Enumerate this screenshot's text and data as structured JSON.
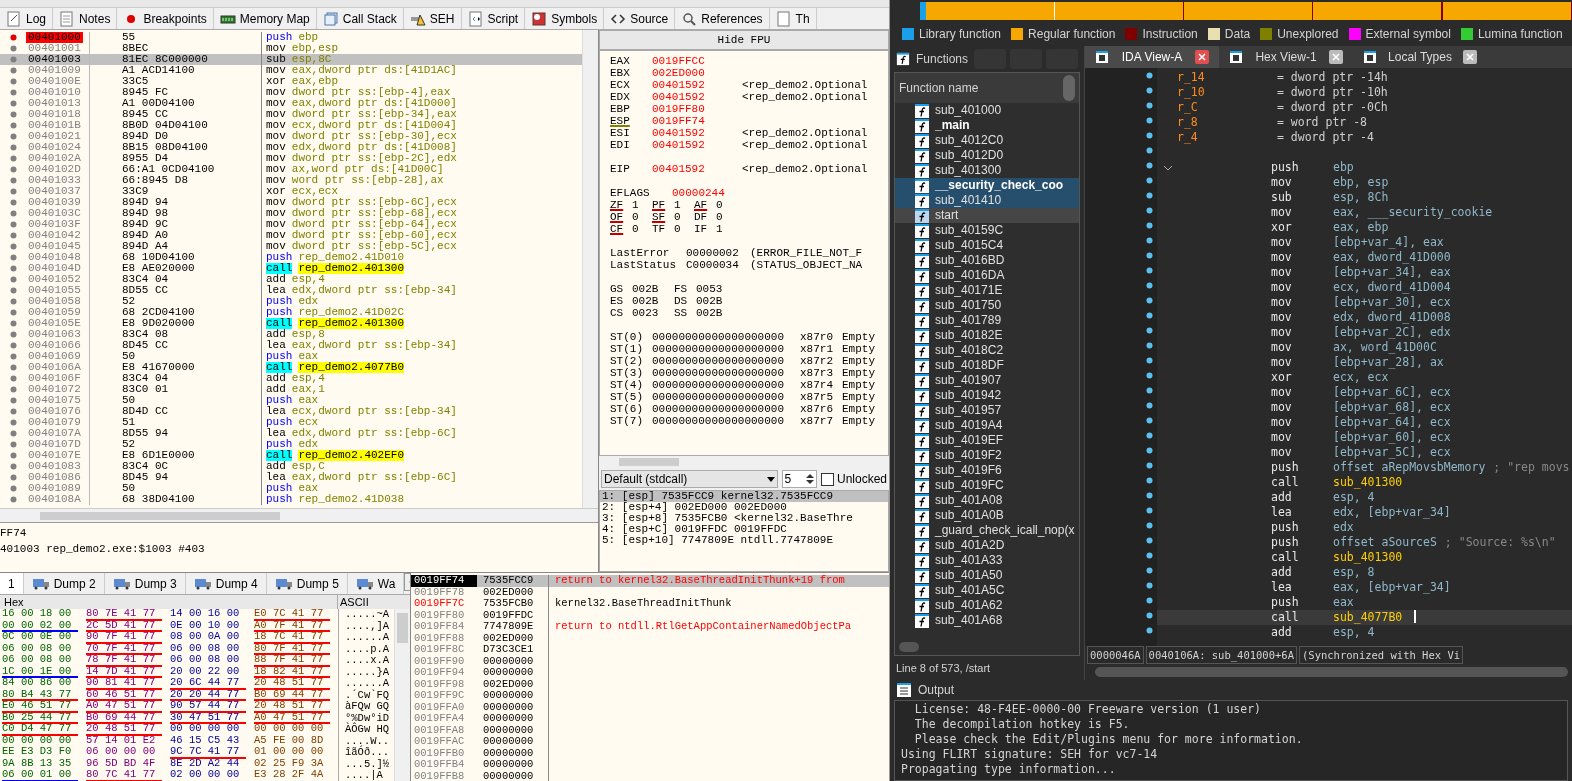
{
  "x64dbg": {
    "tabs": [
      {
        "label": "Log"
      },
      {
        "label": "Notes"
      },
      {
        "label": "Breakpoints"
      },
      {
        "label": "Memory Map"
      },
      {
        "label": "Call Stack"
      },
      {
        "label": "SEH"
      },
      {
        "label": "Script"
      },
      {
        "label": "Symbols"
      },
      {
        "label": "Source"
      },
      {
        "label": "References"
      },
      {
        "label": "Th"
      }
    ],
    "disassembly": [
      {
        "address": "00401000",
        "bytes": "55",
        "mnemonic": "push",
        "operands": "ebp",
        "kind": "push",
        "breakpoint": true,
        "selected": false
      },
      {
        "address": "00401001",
        "bytes": "8BEC",
        "mnemonic": "mov",
        "operands": "ebp,esp",
        "kind": "plain",
        "breakpoint": false,
        "selected": false
      },
      {
        "address": "00401003",
        "bytes": "81EC 8C000000",
        "mnemonic": "sub",
        "operands": "esp,8C",
        "kind": "plain",
        "breakpoint": false,
        "selected": true
      },
      {
        "address": "00401009",
        "bytes": "A1 ACD14100",
        "mnemonic": "mov",
        "operands": "eax,dword ptr ds:[41D1AC]",
        "kind": "plain",
        "breakpoint": false,
        "selected": false
      },
      {
        "address": "0040100E",
        "bytes": "33C5",
        "mnemonic": "xor",
        "operands": "eax,ebp",
        "kind": "plain",
        "breakpoint": false,
        "selected": false
      },
      {
        "address": "00401010",
        "bytes": "8945 FC",
        "mnemonic": "mov",
        "operands": "dword ptr ss:[ebp-4],eax",
        "kind": "plain",
        "breakpoint": false,
        "selected": false
      },
      {
        "address": "00401013",
        "bytes": "A1 00D04100",
        "mnemonic": "mov",
        "operands": "eax,dword ptr ds:[41D000]",
        "kind": "plain",
        "breakpoint": false,
        "selected": false
      },
      {
        "address": "00401018",
        "bytes": "8945 CC",
        "mnemonic": "mov",
        "operands": "dword ptr ss:[ebp-34],eax",
        "kind": "plain",
        "breakpoint": false,
        "selected": false
      },
      {
        "address": "0040101B",
        "bytes": "8B0D 04D04100",
        "mnemonic": "mov",
        "operands": "ecx,dword ptr ds:[41D004]",
        "kind": "plain",
        "breakpoint": false,
        "selected": false
      },
      {
        "address": "00401021",
        "bytes": "894D D0",
        "mnemonic": "mov",
        "operands": "dword ptr ss:[ebp-30],ecx",
        "kind": "plain",
        "breakpoint": false,
        "selected": false
      },
      {
        "address": "00401024",
        "bytes": "8B15 08D04100",
        "mnemonic": "mov",
        "operands": "edx,dword ptr ds:[41D008]",
        "kind": "plain",
        "breakpoint": false,
        "selected": false
      },
      {
        "address": "0040102A",
        "bytes": "8955 D4",
        "mnemonic": "mov",
        "operands": "dword ptr ss:[ebp-2C],edx",
        "kind": "plain",
        "breakpoint": false,
        "selected": false
      },
      {
        "address": "0040102D",
        "bytes": "66:A1 0CD04100",
        "mnemonic": "mov",
        "operands": "ax,word ptr ds:[41D00C]",
        "kind": "plain",
        "breakpoint": false,
        "selected": false
      },
      {
        "address": "00401033",
        "bytes": "66:8945 D8",
        "mnemonic": "mov",
        "operands": "word ptr ss:[ebp-28],ax",
        "kind": "plain",
        "breakpoint": false,
        "selected": false
      },
      {
        "address": "00401037",
        "bytes": "33C9",
        "mnemonic": "xor",
        "operands": "ecx,ecx",
        "kind": "plain",
        "breakpoint": false,
        "selected": false
      },
      {
        "address": "00401039",
        "bytes": "894D 94",
        "mnemonic": "mov",
        "operands": "dword ptr ss:[ebp-6C],ecx",
        "kind": "plain",
        "breakpoint": false,
        "selected": false
      },
      {
        "address": "0040103C",
        "bytes": "894D 98",
        "mnemonic": "mov",
        "operands": "dword ptr ss:[ebp-68],ecx",
        "kind": "plain",
        "breakpoint": false,
        "selected": false
      },
      {
        "address": "0040103F",
        "bytes": "894D 9C",
        "mnemonic": "mov",
        "operands": "dword ptr ss:[ebp-64],ecx",
        "kind": "plain",
        "breakpoint": false,
        "selected": false
      },
      {
        "address": "00401042",
        "bytes": "894D A0",
        "mnemonic": "mov",
        "operands": "dword ptr ss:[ebp-60],ecx",
        "kind": "plain",
        "breakpoint": false,
        "selected": false
      },
      {
        "address": "00401045",
        "bytes": "894D A4",
        "mnemonic": "mov",
        "operands": "dword ptr ss:[ebp-5C],ecx",
        "kind": "plain",
        "breakpoint": false,
        "selected": false
      },
      {
        "address": "00401048",
        "bytes": "68 10D04100",
        "mnemonic": "push",
        "operands": "rep_demo2.41D010",
        "kind": "push",
        "breakpoint": false,
        "selected": false
      },
      {
        "address": "0040104D",
        "bytes": "E8 AE020000",
        "mnemonic": "call",
        "operands": "rep_demo2.401300",
        "kind": "call",
        "breakpoint": false,
        "selected": false
      },
      {
        "address": "00401052",
        "bytes": "83C4 04",
        "mnemonic": "add",
        "operands": "esp,4",
        "kind": "plain",
        "breakpoint": false,
        "selected": false
      },
      {
        "address": "00401055",
        "bytes": "8D55 CC",
        "mnemonic": "lea",
        "operands": "edx,dword ptr ss:[ebp-34]",
        "kind": "plain",
        "breakpoint": false,
        "selected": false
      },
      {
        "address": "00401058",
        "bytes": "52",
        "mnemonic": "push",
        "operands": "edx",
        "kind": "push",
        "breakpoint": false,
        "selected": false
      },
      {
        "address": "00401059",
        "bytes": "68 2CD04100",
        "mnemonic": "push",
        "operands": "rep_demo2.41D02C",
        "kind": "push",
        "breakpoint": false,
        "selected": false
      },
      {
        "address": "0040105E",
        "bytes": "E8 9D020000",
        "mnemonic": "call",
        "operands": "rep_demo2.401300",
        "kind": "call",
        "breakpoint": false,
        "selected": false
      },
      {
        "address": "00401063",
        "bytes": "83C4 08",
        "mnemonic": "add",
        "operands": "esp,8",
        "kind": "plain",
        "breakpoint": false,
        "selected": false
      },
      {
        "address": "00401066",
        "bytes": "8D45 CC",
        "mnemonic": "lea",
        "operands": "eax,dword ptr ss:[ebp-34]",
        "kind": "plain",
        "breakpoint": false,
        "selected": false
      },
      {
        "address": "00401069",
        "bytes": "50",
        "mnemonic": "push",
        "operands": "eax",
        "kind": "push",
        "breakpoint": false,
        "selected": false
      },
      {
        "address": "0040106A",
        "bytes": "E8 41670000",
        "mnemonic": "call",
        "operands": "rep_demo2.4077B0",
        "kind": "call",
        "breakpoint": false,
        "selected": false
      },
      {
        "address": "0040106F",
        "bytes": "83C4 04",
        "mnemonic": "add",
        "operands": "esp,4",
        "kind": "plain",
        "breakpoint": false,
        "selected": false
      },
      {
        "address": "00401072",
        "bytes": "83C0 01",
        "mnemonic": "add",
        "operands": "eax,1",
        "kind": "plain",
        "breakpoint": false,
        "selected": false
      },
      {
        "address": "00401075",
        "bytes": "50",
        "mnemonic": "push",
        "operands": "eax",
        "kind": "push",
        "breakpoint": false,
        "selected": false
      },
      {
        "address": "00401076",
        "bytes": "8D4D CC",
        "mnemonic": "lea",
        "operands": "ecx,dword ptr ss:[ebp-34]",
        "kind": "plain",
        "breakpoint": false,
        "selected": false
      },
      {
        "address": "00401079",
        "bytes": "51",
        "mnemonic": "push",
        "operands": "ecx",
        "kind": "push",
        "breakpoint": false,
        "selected": false
      },
      {
        "address": "0040107A",
        "bytes": "8D55 94",
        "mnemonic": "lea",
        "operands": "edx,dword ptr ss:[ebp-6C]",
        "kind": "plain",
        "breakpoint": false,
        "selected": false
      },
      {
        "address": "0040107D",
        "bytes": "52",
        "mnemonic": "push",
        "operands": "edx",
        "kind": "push",
        "breakpoint": false,
        "selected": false
      },
      {
        "address": "0040107E",
        "bytes": "E8 6D1E0000",
        "mnemonic": "call",
        "operands": "rep_demo2.402EF0",
        "kind": "call",
        "breakpoint": false,
        "selected": false
      },
      {
        "address": "00401083",
        "bytes": "83C4 0C",
        "mnemonic": "add",
        "operands": "esp,C",
        "kind": "plain",
        "breakpoint": false,
        "selected": false
      },
      {
        "address": "00401086",
        "bytes": "8D45 94",
        "mnemonic": "lea",
        "operands": "eax,dword ptr ss:[ebp-6C]",
        "kind": "plain",
        "breakpoint": false,
        "selected": false
      },
      {
        "address": "00401089",
        "bytes": "50",
        "mnemonic": "push",
        "operands": "eax",
        "kind": "push",
        "breakpoint": false,
        "selected": false
      },
      {
        "address": "0040108A",
        "bytes": "68 38D04100",
        "mnemonic": "push",
        "operands": "rep_demo2.41D038",
        "kind": "push",
        "breakpoint": false,
        "selected": false
      }
    ],
    "fpu_toggle": "Hide FPU",
    "registers": [
      {
        "name": "EAX",
        "value": "0019FFCC",
        "marked": false
      },
      {
        "name": "EBX",
        "value": "002ED000",
        "marked": false
      },
      {
        "name": "ECX",
        "value": "00401592",
        "comment": "<rep_demo2.Optional",
        "marked": false
      },
      {
        "name": "EDX",
        "value": "00401592",
        "comment": "<rep_demo2.Optional",
        "marked": false
      },
      {
        "name": "EBP",
        "value": "0019FF80",
        "marked": false
      },
      {
        "name": "ESP",
        "value": "0019FF74",
        "marked": true
      },
      {
        "name": "ESI",
        "value": "00401592",
        "comment": "<rep_demo2.Optional",
        "marked": false
      },
      {
        "name": "EDI",
        "value": "00401592",
        "comment": "<rep_demo2.Optional",
        "marked": false
      }
    ],
    "eip": {
      "name": "EIP",
      "value": "00401592",
      "comment": "<rep_demo2.Optional"
    },
    "eflags": {
      "name": "EFLAGS",
      "value": "00000244"
    },
    "flags": [
      {
        "name": "ZF",
        "value": "1",
        "marked": true
      },
      {
        "name": "PF",
        "value": "1",
        "marked": true
      },
      {
        "name": "AF",
        "value": "0",
        "marked": true
      },
      {
        "name": "OF",
        "value": "0",
        "marked": true
      },
      {
        "name": "SF",
        "value": "0",
        "marked": true
      },
      {
        "name": "DF",
        "value": "0",
        "marked": false
      },
      {
        "name": "CF",
        "value": "0",
        "marked": true
      },
      {
        "name": "TF",
        "value": "0",
        "marked": false
      },
      {
        "name": "IF",
        "value": "1",
        "marked": false
      }
    ],
    "last": [
      {
        "name": "LastError",
        "value": "00000002",
        "comment": "(ERROR_FILE_NOT_F"
      },
      {
        "name": "LastStatus",
        "value": "C0000034",
        "comment": "(STATUS_OBJECT_NA"
      }
    ],
    "segments": [
      {
        "name": "GS",
        "value": "002B"
      },
      {
        "name": "FS",
        "value": "0053"
      },
      {
        "name": "ES",
        "value": "002B"
      },
      {
        "name": "DS",
        "value": "002B"
      },
      {
        "name": "CS",
        "value": "0023"
      },
      {
        "name": "SS",
        "value": "002B"
      }
    ],
    "fpu": [
      {
        "name": "ST(0)",
        "value": "00000000000000000000",
        "tag": "x87r0",
        "state": "Empty"
      },
      {
        "name": "ST(1)",
        "value": "00000000000000000000",
        "tag": "x87r1",
        "state": "Empty"
      },
      {
        "name": "ST(2)",
        "value": "00000000000000000000",
        "tag": "x87r2",
        "state": "Empty"
      },
      {
        "name": "ST(3)",
        "value": "00000000000000000000",
        "tag": "x87r3",
        "state": "Empty"
      },
      {
        "name": "ST(4)",
        "value": "00000000000000000000",
        "tag": "x87r4",
        "state": "Empty"
      },
      {
        "name": "ST(5)",
        "value": "00000000000000000000",
        "tag": "x87r5",
        "state": "Empty"
      },
      {
        "name": "ST(6)",
        "value": "00000000000000000000",
        "tag": "x87r6",
        "state": "Empty"
      },
      {
        "name": "ST(7)",
        "value": "00000000000000000000",
        "tag": "x87r7",
        "state": "Empty"
      }
    ],
    "call_convention": {
      "value": "Default (stdcall)",
      "count": "5",
      "lock_label": "Unlocked",
      "checked": false
    },
    "arguments": [
      {
        "text": "1: [esp] 7535FCC9 kernel32.7535FCC9",
        "selected": true
      },
      {
        "text": "2: [esp+4] 002ED000 002ED000",
        "selected": false
      },
      {
        "text": "3: [esp+8] 7535FCB0 <kernel32.BaseThre",
        "selected": false
      },
      {
        "text": "4: [esp+C] 0019FFDC 0019FFDC",
        "selected": false
      },
      {
        "text": "5: [esp+10] 7747809E ntdll.7747809E",
        "selected": false
      }
    ],
    "info": [
      "FF74",
      "401003 rep_demo2.exe:$1003 #403"
    ],
    "dump_tabs": [
      {
        "label": "1",
        "selected": true
      },
      {
        "label": "Dump 2",
        "selected": false
      },
      {
        "label": "Dump 3",
        "selected": false
      },
      {
        "label": "Dump 4",
        "selected": false
      },
      {
        "label": "Dump 5",
        "selected": false
      },
      {
        "label": "Wa",
        "selected": false
      }
    ],
    "hex_header": "Hex",
    "ascii_header": "ASCII",
    "hex_rows": [
      {
        "groups": [
          {
            "text": "16 00 18 00",
            "underlined": false
          },
          {
            "text": "80 7E 41 77",
            "underlined": true,
            "color": "#ff0000"
          },
          {
            "text": "14 00 16 00",
            "underlined": false
          },
          {
            "text": "E0 7C 41 77",
            "underlined": true,
            "color": "#ff0000"
          }
        ],
        "ascii": ".....~A"
      },
      {
        "groups": [
          {
            "text": "00 00 02 00",
            "underlined": true,
            "color": "#0000ff"
          },
          {
            "text": "2C 5D 41 77",
            "underlined": true,
            "color": "#ff0000"
          },
          {
            "text": "0E 00 10 00",
            "underlined": false
          },
          {
            "text": "A0 7F 41 77",
            "underlined": true,
            "color": "#ff0000"
          }
        ],
        "ascii": "....,]A"
      },
      {
        "groups": [
          {
            "text": "0C 00 0E 00",
            "underlined": false
          },
          {
            "text": "90 7F 41 77",
            "underlined": true,
            "color": "#ff0000"
          },
          {
            "text": "08 00 0A 00",
            "underlined": false
          },
          {
            "text": "18 7C 41 77",
            "underlined": true,
            "color": "#ff0000"
          }
        ],
        "ascii": "......A"
      },
      {
        "groups": [
          {
            "text": "06 00 08 00",
            "underlined": false
          },
          {
            "text": "70 7F 41 77",
            "underlined": true,
            "color": "#ff0000"
          },
          {
            "text": "06 00 08 00",
            "underlined": false
          },
          {
            "text": "80 7F 41 77",
            "underlined": true,
            "color": "#ff0000"
          }
        ],
        "ascii": "....p.A"
      },
      {
        "groups": [
          {
            "text": "06 00 08 00",
            "underlined": false
          },
          {
            "text": "78 7F 41 77",
            "underlined": true,
            "color": "#ff0000"
          },
          {
            "text": "06 00 08 00",
            "underlined": false
          },
          {
            "text": "88 7F 41 77",
            "underlined": true,
            "color": "#ff0000"
          }
        ],
        "ascii": "....x.A"
      },
      {
        "groups": [
          {
            "text": "1C 00 1E 00",
            "underlined": true,
            "color": "#0000ff"
          },
          {
            "text": "14 7D 41 77",
            "underlined": true,
            "color": "#ff0000"
          },
          {
            "text": "20 00 22 00",
            "underlined": false
          },
          {
            "text": "18 82 41 77",
            "underlined": true,
            "color": "#ff0000"
          }
        ],
        "ascii": ".....}A"
      },
      {
        "groups": [
          {
            "text": "84 00 86 00",
            "underlined": false
          },
          {
            "text": "90 81 41 77",
            "underlined": true,
            "color": "#ff0000"
          },
          {
            "text": "20 6C 44 77",
            "underlined": true,
            "color": "#ff0000"
          },
          {
            "text": "20 48 51 77",
            "underlined": true,
            "color": "#ff0000"
          }
        ],
        "ascii": "......A"
      },
      {
        "groups": [
          {
            "text": "80 B4 43 77",
            "underlined": true,
            "color": "#ff0000"
          },
          {
            "text": "60 46 51 77",
            "underlined": true,
            "color": "#ff0000"
          },
          {
            "text": "20 20 44 77",
            "underlined": true,
            "color": "#ff0000"
          },
          {
            "text": "B0 69 44 77",
            "underlined": true,
            "color": "#ff0000"
          }
        ],
        "ascii": ".´Cw`FQ"
      },
      {
        "groups": [
          {
            "text": "E0 46 51 77",
            "underlined": true,
            "color": "#ff0000"
          },
          {
            "text": "A0 47 51 77",
            "underlined": true,
            "color": "#ff0000"
          },
          {
            "text": "90 57 44 77",
            "underlined": true,
            "color": "#ff0000"
          },
          {
            "text": "20 48 51 77",
            "underlined": true,
            "color": "#ff0000"
          }
        ],
        "ascii": "àFQw GQ"
      },
      {
        "groups": [
          {
            "text": "B0 25 44 77",
            "underlined": true,
            "color": "#ff0000"
          },
          {
            "text": "B0 69 44 77",
            "underlined": true,
            "color": "#ff0000"
          },
          {
            "text": "30 47 51 77",
            "underlined": true,
            "color": "#ff0000"
          },
          {
            "text": "A0 47 51 77",
            "underlined": true,
            "color": "#ff0000"
          }
        ],
        "ascii": "°%Dw°iD"
      },
      {
        "groups": [
          {
            "text": "C0 D4 47 77",
            "underlined": true,
            "color": "#ff0000"
          },
          {
            "text": "20 48 51 77",
            "underlined": true,
            "color": "#ff0000"
          },
          {
            "text": "00 00 00 00",
            "underlined": false
          },
          {
            "text": "00 00 00 00",
            "underlined": false
          }
        ],
        "ascii": "ÀÔGw HQ"
      },
      {
        "groups": [
          {
            "text": "00 00 00 00",
            "underlined": false
          },
          {
            "text": "57 14 01 E2",
            "underlined": false
          },
          {
            "text": "46 15 C5 43",
            "underlined": false
          },
          {
            "text": "A5 FE 00 8D",
            "underlined": false
          }
        ],
        "ascii": "....W.."
      },
      {
        "groups": [
          {
            "text": "EE E3 D3 F0",
            "underlined": false
          },
          {
            "text": "06 00 00 00",
            "underlined": false
          },
          {
            "text": "9C 7C 41 77",
            "underlined": true,
            "color": "#ff0000"
          },
          {
            "text": "01 00 00 00",
            "underlined": false
          }
        ],
        "ascii": "îãÓð..."
      },
      {
        "groups": [
          {
            "text": "9A 8B 13 35",
            "underlined": false
          },
          {
            "text": "96 5D BD 4F",
            "underlined": false
          },
          {
            "text": "8E 2D A2 44",
            "underlined": false
          },
          {
            "text": "02 25 F9 3A",
            "underlined": false
          }
        ],
        "ascii": "...5.]½"
      },
      {
        "groups": [
          {
            "text": "06 00 01 00",
            "underlined": true,
            "color": "#0000ff"
          },
          {
            "text": "80 7C 41 77",
            "underlined": true,
            "color": "#ff0000"
          },
          {
            "text": "02 00 00 00",
            "underlined": false
          },
          {
            "text": "E3 28 2F 4A",
            "underlined": false
          }
        ],
        "ascii": "....|A"
      }
    ],
    "stack": [
      {
        "address": "0019FF74",
        "value": "7535FCC9",
        "comment": "return to kernel32.BaseThreadInitThunk+19 from",
        "kind": "return",
        "selected": true,
        "marked": false
      },
      {
        "address": "0019FF78",
        "value": "002ED000",
        "kind": "none",
        "selected": false,
        "marked": false
      },
      {
        "address": "0019FF7C",
        "value": "7535FCB0",
        "comment": "kernel32.BaseThreadInitThunk",
        "kind": "label",
        "selected": false,
        "marked": true
      },
      {
        "address": "0019FF80",
        "value": "0019FFDC",
        "kind": "none",
        "selected": false,
        "marked": false
      },
      {
        "address": "0019FF84",
        "value": "7747809E",
        "comment": "return to ntdll.RtlGetAppContainerNamedObjectPa",
        "kind": "return",
        "selected": false,
        "marked": false
      },
      {
        "address": "0019FF88",
        "value": "002ED000",
        "kind": "none",
        "selected": false,
        "marked": false
      },
      {
        "address": "0019FF8C",
        "value": "D73C3CE1",
        "kind": "none",
        "selected": false,
        "marked": false
      },
      {
        "address": "0019FF90",
        "value": "00000000",
        "kind": "none",
        "selected": false,
        "marked": false
      },
      {
        "address": "0019FF94",
        "value": "00000000",
        "kind": "none",
        "selected": false,
        "marked": false
      },
      {
        "address": "0019FF98",
        "value": "002ED000",
        "kind": "none",
        "selected": false,
        "marked": false
      },
      {
        "address": "0019FF9C",
        "value": "00000000",
        "kind": "none",
        "selected": false,
        "marked": false
      },
      {
        "address": "0019FFA0",
        "value": "00000000",
        "kind": "none",
        "selected": false,
        "marked": false
      },
      {
        "address": "0019FFA4",
        "value": "00000000",
        "kind": "none",
        "selected": false,
        "marked": false
      },
      {
        "address": "0019FFA8",
        "value": "00000000",
        "kind": "none",
        "selected": false,
        "marked": false
      },
      {
        "address": "0019FFAC",
        "value": "00000000",
        "kind": "none",
        "selected": false,
        "marked": false
      },
      {
        "address": "0019FFB0",
        "value": "00000000",
        "kind": "none",
        "selected": false,
        "marked": false
      },
      {
        "address": "0019FFB4",
        "value": "00000000",
        "kind": "none",
        "selected": false,
        "marked": false
      },
      {
        "address": "0019FFB8",
        "value": "00000000",
        "kind": "none",
        "selected": false,
        "marked": false
      }
    ]
  },
  "ida": {
    "legend": [
      {
        "label": "Library function",
        "color": "#1a9fe8"
      },
      {
        "label": "Regular function",
        "color": "#f6a800"
      },
      {
        "label": "Instruction",
        "color": "#800000"
      },
      {
        "label": "Data",
        "color": "#e8e0b0"
      },
      {
        "label": "Unexplored",
        "color": "#808000"
      },
      {
        "label": "External symbol",
        "color": "#ff00ff"
      },
      {
        "label": "Lumina function",
        "color": "#33cc33"
      }
    ],
    "functions_title": "Functions",
    "functions_header": "Function name",
    "functions": [
      {
        "name": "sub_401000",
        "bold": false,
        "selected": false,
        "current": false
      },
      {
        "name": "_main",
        "bold": true,
        "selected": false,
        "current": false
      },
      {
        "name": "sub_4012C0",
        "bold": false,
        "selected": false,
        "current": false
      },
      {
        "name": "sub_4012D0",
        "bold": false,
        "selected": false,
        "current": false
      },
      {
        "name": "sub_401300",
        "bold": false,
        "selected": false,
        "current": false
      },
      {
        "name": "__security_check_coo",
        "bold": true,
        "selected": true,
        "current": false
      },
      {
        "name": "sub_401410",
        "bold": false,
        "selected": true,
        "current": false
      },
      {
        "name": "start",
        "bold": false,
        "selected": false,
        "current": true
      },
      {
        "name": "sub_40159C",
        "bold": false,
        "selected": false,
        "current": false
      },
      {
        "name": "sub_4015C4",
        "bold": false,
        "selected": false,
        "current": false
      },
      {
        "name": "sub_4016BD",
        "bold": false,
        "selected": false,
        "current": false
      },
      {
        "name": "sub_4016DA",
        "bold": false,
        "selected": false,
        "current": false
      },
      {
        "name": "sub_40171E",
        "bold": false,
        "selected": false,
        "current": false
      },
      {
        "name": "sub_401750",
        "bold": false,
        "selected": false,
        "current": false
      },
      {
        "name": "sub_401789",
        "bold": false,
        "selected": false,
        "current": false
      },
      {
        "name": "sub_40182E",
        "bold": false,
        "selected": false,
        "current": false
      },
      {
        "name": "sub_4018C2",
        "bold": false,
        "selected": false,
        "current": false
      },
      {
        "name": "sub_4018DF",
        "bold": false,
        "selected": false,
        "current": false
      },
      {
        "name": "sub_401907",
        "bold": false,
        "selected": false,
        "current": false
      },
      {
        "name": "sub_401942",
        "bold": false,
        "selected": false,
        "current": false
      },
      {
        "name": "sub_401957",
        "bold": false,
        "selected": false,
        "current": false
      },
      {
        "name": "sub_4019A4",
        "bold": false,
        "selected": false,
        "current": false
      },
      {
        "name": "sub_4019EF",
        "bold": false,
        "selected": false,
        "current": false
      },
      {
        "name": "sub_4019F2",
        "bold": false,
        "selected": false,
        "current": false
      },
      {
        "name": "sub_4019F6",
        "bold": false,
        "selected": false,
        "current": false
      },
      {
        "name": "sub_4019FC",
        "bold": false,
        "selected": false,
        "current": false
      },
      {
        "name": "sub_401A08",
        "bold": false,
        "selected": false,
        "current": false
      },
      {
        "name": "sub_401A0B",
        "bold": false,
        "selected": false,
        "current": false
      },
      {
        "name": "_guard_check_icall_nop(x",
        "bold": false,
        "selected": false,
        "current": false
      },
      {
        "name": "sub_401A2D",
        "bold": false,
        "selected": false,
        "current": false
      },
      {
        "name": "sub_401A33",
        "bold": false,
        "selected": false,
        "current": false
      },
      {
        "name": "sub_401A50",
        "bold": false,
        "selected": false,
        "current": false
      },
      {
        "name": "sub_401A5C",
        "bold": false,
        "selected": false,
        "current": false
      },
      {
        "name": "sub_401A62",
        "bold": false,
        "selected": false,
        "current": false
      },
      {
        "name": "sub_401A68",
        "bold": false,
        "selected": false,
        "current": false
      }
    ],
    "functions_status": "Line 8 of 573, /start",
    "tabs": [
      {
        "label": "IDA View-A",
        "selected": true
      },
      {
        "label": "Hex View-1",
        "selected": false
      },
      {
        "label": "Local Types",
        "selected": false
      }
    ],
    "vars": [
      {
        "name": "r_14",
        "def": "= dword ptr -14h"
      },
      {
        "name": "r_10",
        "def": "= dword ptr -10h"
      },
      {
        "name": "r_C",
        "def": "= dword ptr -0Ch"
      },
      {
        "name": "r_8",
        "def": "= word ptr -8"
      },
      {
        "name": "r_4",
        "def": "= dword ptr -4"
      }
    ],
    "code": [
      {
        "mnemonic": "push",
        "operands": "ebp",
        "kind": "plain",
        "current": false
      },
      {
        "mnemonic": "mov",
        "operands": "ebp, esp",
        "kind": "plain",
        "current": false
      },
      {
        "mnemonic": "sub",
        "operands": "esp, 8Ch",
        "kind": "plain",
        "current": false
      },
      {
        "mnemonic": "mov",
        "operands": "eax, ___security_cookie",
        "kind": "plain",
        "current": false
      },
      {
        "mnemonic": "xor",
        "operands": "eax, ebp",
        "kind": "plain",
        "current": false
      },
      {
        "mnemonic": "mov",
        "operands": "[ebp+var_4], eax",
        "kind": "plain",
        "current": false
      },
      {
        "mnemonic": "mov",
        "operands": "eax, dword_41D000",
        "kind": "plain",
        "current": false
      },
      {
        "mnemonic": "mov",
        "operands": "[ebp+var_34], eax",
        "kind": "plain",
        "current": false
      },
      {
        "mnemonic": "mov",
        "operands": "ecx, dword_41D004",
        "kind": "plain",
        "current": false
      },
      {
        "mnemonic": "mov",
        "operands": "[ebp+var_30], ecx",
        "kind": "plain",
        "current": false
      },
      {
        "mnemonic": "mov",
        "operands": "edx, dword_41D008",
        "kind": "plain",
        "current": false
      },
      {
        "mnemonic": "mov",
        "operands": "[ebp+var_2C], edx",
        "kind": "plain",
        "current": false
      },
      {
        "mnemonic": "mov",
        "operands": "ax, word_41D00C",
        "kind": "plain",
        "current": false
      },
      {
        "mnemonic": "mov",
        "operands": "[ebp+var_28], ax",
        "kind": "plain",
        "current": false
      },
      {
        "mnemonic": "xor",
        "operands": "ecx, ecx",
        "kind": "plain",
        "current": false
      },
      {
        "mnemonic": "mov",
        "operands": "[ebp+var_6C], ecx",
        "kind": "plain",
        "current": false
      },
      {
        "mnemonic": "mov",
        "operands": "[ebp+var_68], ecx",
        "kind": "plain",
        "current": false
      },
      {
        "mnemonic": "mov",
        "operands": "[ebp+var_64], ecx",
        "kind": "plain",
        "current": false
      },
      {
        "mnemonic": "mov",
        "operands": "[ebp+var_60], ecx",
        "kind": "plain",
        "current": false
      },
      {
        "mnemonic": "mov",
        "operands": "[ebp+var_5C], ecx",
        "kind": "plain",
        "current": false
      },
      {
        "mnemonic": "push",
        "operands": "offset aRepMovsbMemory",
        "comment": "; \"rep movs",
        "kind": "plain",
        "current": false
      },
      {
        "mnemonic": "call",
        "operands": "sub_401300",
        "kind": "call",
        "current": false
      },
      {
        "mnemonic": "add",
        "operands": "esp, 4",
        "kind": "plain",
        "current": false
      },
      {
        "mnemonic": "lea",
        "operands": "edx, [ebp+var_34]",
        "kind": "plain",
        "current": false
      },
      {
        "mnemonic": "push",
        "operands": "edx",
        "kind": "plain",
        "current": false
      },
      {
        "mnemonic": "push",
        "operands": "offset aSourceS",
        "comment": "; \"Source: %s\\n\"",
        "kind": "plain",
        "current": false
      },
      {
        "mnemonic": "call",
        "operands": "sub_401300",
        "kind": "call",
        "current": false
      },
      {
        "mnemonic": "add",
        "operands": "esp, 8",
        "kind": "plain",
        "current": false
      },
      {
        "mnemonic": "lea",
        "operands": "eax, [ebp+var_34]",
        "kind": "plain",
        "current": false
      },
      {
        "mnemonic": "push",
        "operands": "eax",
        "kind": "plain",
        "current": false
      },
      {
        "mnemonic": "call",
        "operands": "sub_4077B0",
        "kind": "call",
        "current": true
      },
      {
        "mnemonic": "add",
        "operands": "esp, 4",
        "kind": "plain",
        "current": false
      }
    ],
    "status": [
      "0000046A",
      "0040106A: sub_401000+6A",
      "(Synchronized with Hex Vi"
    ],
    "output_title": "Output",
    "output": [
      "  License: 48-F4EE-0000-00 Freeware version (1 user)",
      "  The decompilation hotkey is F5.",
      "  Please check the Edit/Plugins menu for more information.",
      "Using FLIRT signature: SEH for vc7-14",
      "Propagating type information..."
    ]
  }
}
